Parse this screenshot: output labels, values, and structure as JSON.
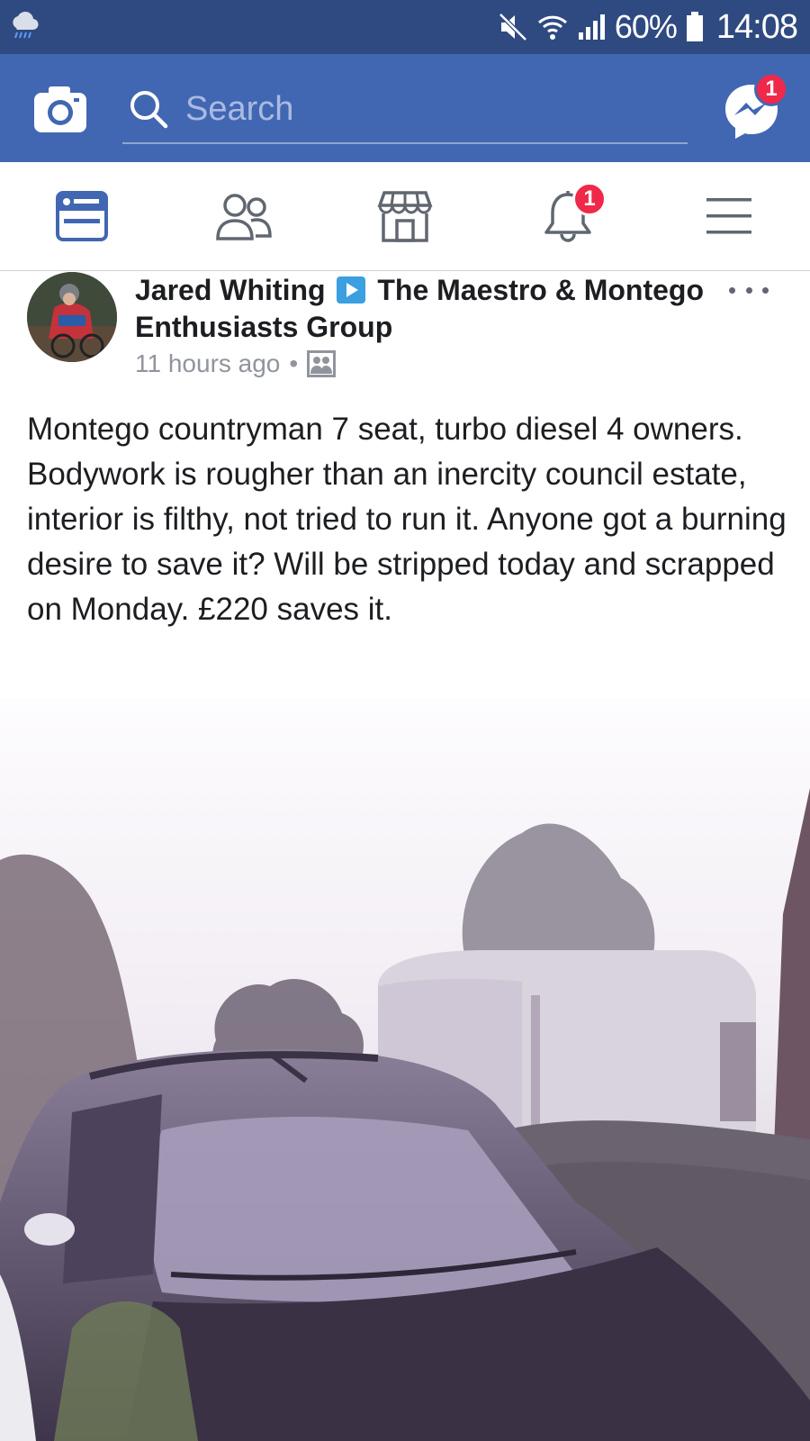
{
  "status_bar": {
    "weather_icon": "rain-cloud-icon",
    "battery": "60%",
    "time": "14:08"
  },
  "header": {
    "search": {
      "placeholder": "Search",
      "value": ""
    },
    "messenger_badge": "1",
    "brand_color": "#4267b2"
  },
  "tabs": [
    {
      "name": "news-feed",
      "icon": "news-feed-icon",
      "active": true
    },
    {
      "name": "friends",
      "icon": "friends-icon",
      "active": false
    },
    {
      "name": "marketplace",
      "icon": "marketplace-icon",
      "active": false
    },
    {
      "name": "notifications",
      "icon": "bell-icon",
      "badge": "1",
      "active": false
    },
    {
      "name": "menu",
      "icon": "hamburger-menu-icon",
      "active": false
    }
  ],
  "post": {
    "author": "Jared Whiting",
    "group": "The Maestro & Montego Enthusiasts Group",
    "time": "11 hours ago",
    "meta_separator": "•",
    "privacy_icon": "group-icon",
    "text": "Montego countryman 7 seat, turbo diesel 4 owners. Bodywork is rougher than an inercity council estate, interior is filthy, not tried to run it. Anyone got a burning desire to save it? Will be stripped today and scrapped on Monday. £220 saves it."
  },
  "colors": {
    "status_bar": "#2f4a80",
    "header": "#4267b2",
    "badge": "#f02849",
    "active_tab": "#4267b2",
    "inactive_tab": "#606770"
  }
}
